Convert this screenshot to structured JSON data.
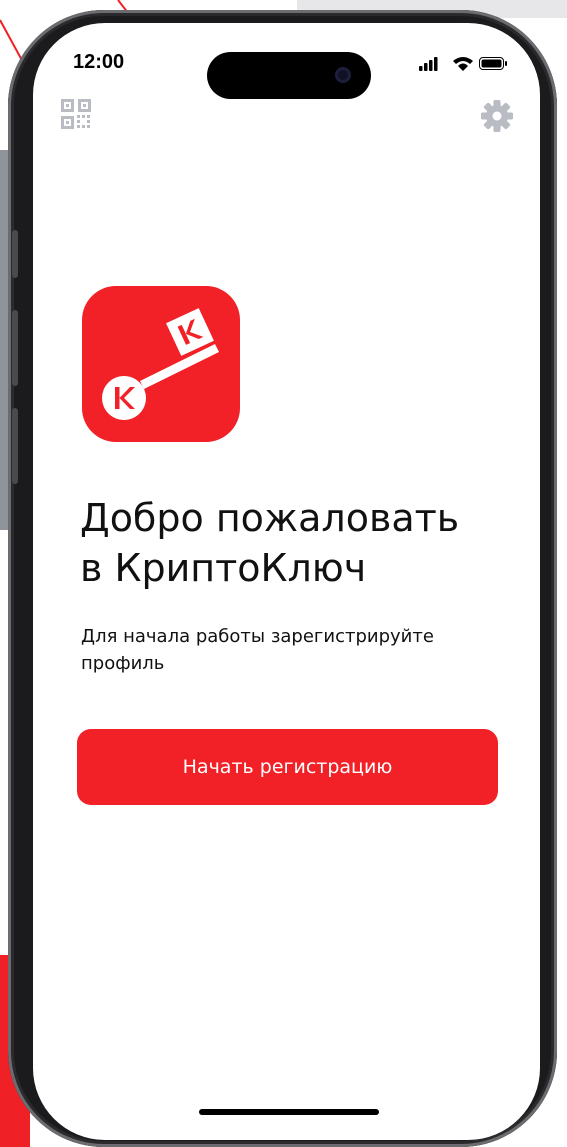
{
  "status_bar": {
    "time": "12:00",
    "icons": [
      "cellular-signal-icon",
      "wifi-icon",
      "battery-icon"
    ]
  },
  "toolbar": {
    "left_icon": "qr-code-icon",
    "right_icon": "gear-icon"
  },
  "logo": {
    "name": "cryptokey-logo",
    "badge_letter": "К",
    "color": "#f12127"
  },
  "welcome": {
    "title_line1": "Добро пожаловать",
    "title_line2": "в КриптоКлюч",
    "subtitle_line1": "Для начала работы зарегистрируйте",
    "subtitle_line2": "профиль"
  },
  "cta": {
    "label": "Начать регистрацию",
    "color": "#f12127"
  }
}
